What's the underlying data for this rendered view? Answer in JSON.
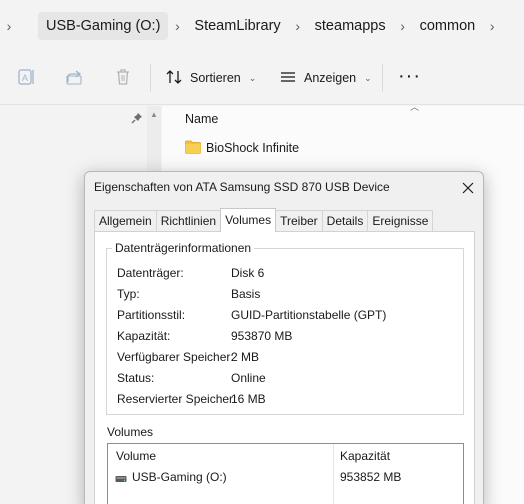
{
  "breadcrumb": {
    "items": [
      "USB-Gaming (O:)",
      "SteamLibrary",
      "steamapps",
      "common"
    ]
  },
  "toolbar": {
    "sort_label": "Sortieren",
    "view_label": "Anzeigen",
    "icons": [
      "rename-icon",
      "share-icon",
      "delete-icon",
      "sort-icon",
      "view-icon",
      "more-icon"
    ]
  },
  "filelist": {
    "column_name": "Name",
    "files": [
      {
        "name": "BioShock Infinite",
        "icon": "folder-icon"
      }
    ]
  },
  "dialog": {
    "title": "Eigenschaften von ATA Samsung SSD 870 USB Device",
    "tabs": [
      "Allgemein",
      "Richtlinien",
      "Volumes",
      "Treiber",
      "Details",
      "Ereignisse"
    ],
    "active_tab": "Volumes",
    "group_title": "Datenträgerinformationen",
    "info": [
      {
        "label": "Datenträger:",
        "value": "Disk 6"
      },
      {
        "label": "Typ:",
        "value": "Basis"
      },
      {
        "label": "Partitionsstil:",
        "value": "GUID-Partitionstabelle (GPT)"
      },
      {
        "label": "Kapazität:",
        "value": "953870 MB"
      },
      {
        "label": "Verfügbarer Speicher:",
        "value": "2 MB"
      },
      {
        "label": "Status:",
        "value": "Online"
      },
      {
        "label": "Reservierter Speicher:",
        "value": "16 MB"
      }
    ],
    "volumes_label": "Volumes",
    "volumes_columns": {
      "name": "Volume",
      "capacity": "Kapazität"
    },
    "volumes": [
      {
        "name": "USB-Gaming (O:)",
        "capacity": "953852 MB",
        "icon": "drive-icon"
      }
    ]
  },
  "colors": {
    "folder": "#f3c13a",
    "accent": "#0067c0"
  }
}
